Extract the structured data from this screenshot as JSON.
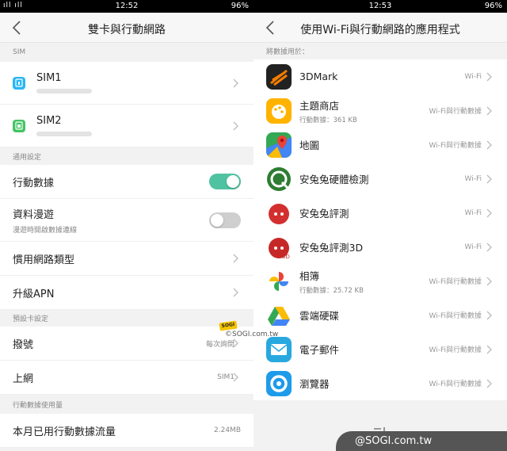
{
  "left": {
    "status": {
      "signal": "ıll ıll",
      "time": "12:52",
      "battery": "96%"
    },
    "title": "雙卡與行動網路",
    "sections": {
      "sim": "SIM",
      "general": "通用設定",
      "default_card": "預設卡設定",
      "usage": "行動數據使用量"
    },
    "sim1": {
      "label": "SIM1",
      "color": "#29b6f6"
    },
    "sim2": {
      "label": "SIM2",
      "color": "#43c463"
    },
    "mobile_data": {
      "label": "行動數據",
      "on": true
    },
    "roaming": {
      "label": "資料漫遊",
      "sub": "漫遊時開啟數據連線",
      "on": false
    },
    "preferred_network": {
      "label": "慣用網路類型"
    },
    "upgrade_apn": {
      "label": "升級APN"
    },
    "dial": {
      "label": "撥號",
      "value": "每次詢問"
    },
    "internet": {
      "label": "上網",
      "value": "SIM1"
    },
    "monthly_usage": {
      "label": "本月已用行動數據流量",
      "value": "2.24MB"
    },
    "toggle_on_color": "#4fc3a1",
    "toggle_off_color": "#cfcfcf"
  },
  "right": {
    "status": {
      "time": "12:53",
      "battery": "96%"
    },
    "title": "使用Wi-Fi與行動網路的應用程式",
    "section": "將數據用於：",
    "apps": [
      {
        "name": "3DMark",
        "usage": "",
        "network": "Wi-Fi",
        "icon": "3dmark-icon"
      },
      {
        "name": "主題商店",
        "usage": "行動數據：361 KB",
        "network": "Wi-Fi與行動數據",
        "icon": "theme-store-icon"
      },
      {
        "name": "地圖",
        "usage": "",
        "network": "Wi-Fi與行動數據",
        "icon": "maps-icon"
      },
      {
        "name": "安兔兔硬體檢測",
        "usage": "",
        "network": "Wi-Fi",
        "icon": "antutu-hardware-icon"
      },
      {
        "name": "安兔兔評測",
        "usage": "",
        "network": "Wi-Fi",
        "icon": "antutu-benchmark-icon"
      },
      {
        "name": "安兔兔評測3D",
        "usage": "",
        "network": "Wi-Fi",
        "icon": "antutu-3d-icon"
      },
      {
        "name": "相簿",
        "usage": "行動數據：25.72 KB",
        "network": "Wi-Fi與行動數據",
        "icon": "photos-icon"
      },
      {
        "name": "雲端硬碟",
        "usage": "",
        "network": "Wi-Fi與行動數據",
        "icon": "drive-icon"
      },
      {
        "name": "電子郵件",
        "usage": "",
        "network": "Wi-Fi與行動數據",
        "icon": "email-icon"
      },
      {
        "name": "瀏覽器",
        "usage": "",
        "network": "Wi-Fi與行動數據",
        "icon": "browser-icon"
      }
    ]
  },
  "watermark": {
    "badge": "SOGI",
    "text": "©SOGI.com.tw",
    "bottom": "@SOGI.com.tw"
  }
}
